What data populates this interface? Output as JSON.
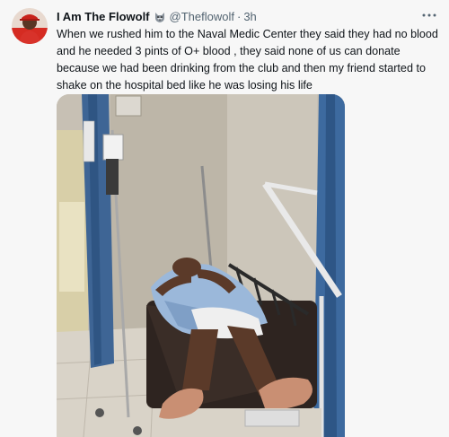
{
  "tweet": {
    "display_name": "I Am The Flowolf",
    "verified_icon": "wolf-emoji-icon",
    "handle": "@Theflowolf",
    "separator": "·",
    "timestamp": "3h",
    "more_icon": "more-dots-icon",
    "text_lines": [
      "When we rushed him to the Naval Medic Center they said they had no blood",
      "and he needed 3 pints of O+ blood , they said none of us can donate",
      "because we had been drinking from the club and then my friend started to",
      "shake on the hospital bed like he was losing his life"
    ]
  },
  "colors": {
    "background": "#f7f7f7",
    "name": "#0f1419",
    "secondary": "#536471"
  }
}
